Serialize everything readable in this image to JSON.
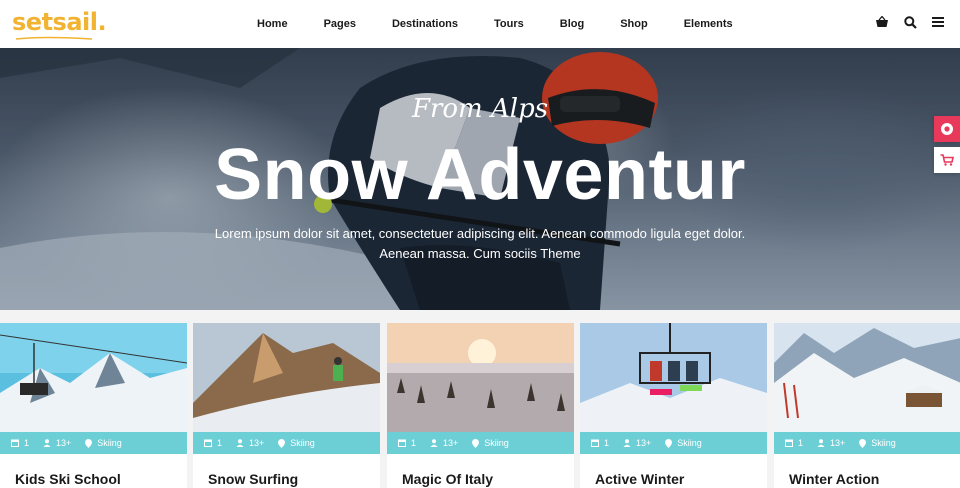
{
  "brand": {
    "logo_text": "setsail.",
    "accent": "#f1b331"
  },
  "nav": {
    "items": [
      "Home",
      "Pages",
      "Destinations",
      "Tours",
      "Blog",
      "Shop",
      "Elements"
    ]
  },
  "header_icons": [
    "basket-icon",
    "search-icon",
    "menu-icon"
  ],
  "hero": {
    "script": "From Alps",
    "title": "Snow Adventur",
    "text": "Lorem ipsum dolor sit amet, consectetuer adipiscing elit. Aenean commodo ligula eget dolor. Aenean massa. Cum sociis Theme"
  },
  "side_widgets": [
    {
      "icon": "lifebuoy-icon",
      "color": "#e8395b"
    },
    {
      "icon": "cart-icon",
      "color": "#e8395b"
    }
  ],
  "cards": [
    {
      "title": "Kids Ski School",
      "days": "1",
      "people": "13+",
      "location": "Skiing"
    },
    {
      "title": "Snow Surfing",
      "days": "1",
      "people": "13+",
      "location": "Skiing"
    },
    {
      "title": "Magic Of Italy",
      "days": "1",
      "people": "13+",
      "location": "Skiing"
    },
    {
      "title": "Active Winter",
      "days": "1",
      "people": "13+",
      "location": "Skiing"
    },
    {
      "title": "Winter Action",
      "days": "1",
      "people": "13+",
      "location": "Skiing"
    }
  ],
  "colors": {
    "meta_bar": "#6ccfd6",
    "side_accent": "#e8395b"
  }
}
